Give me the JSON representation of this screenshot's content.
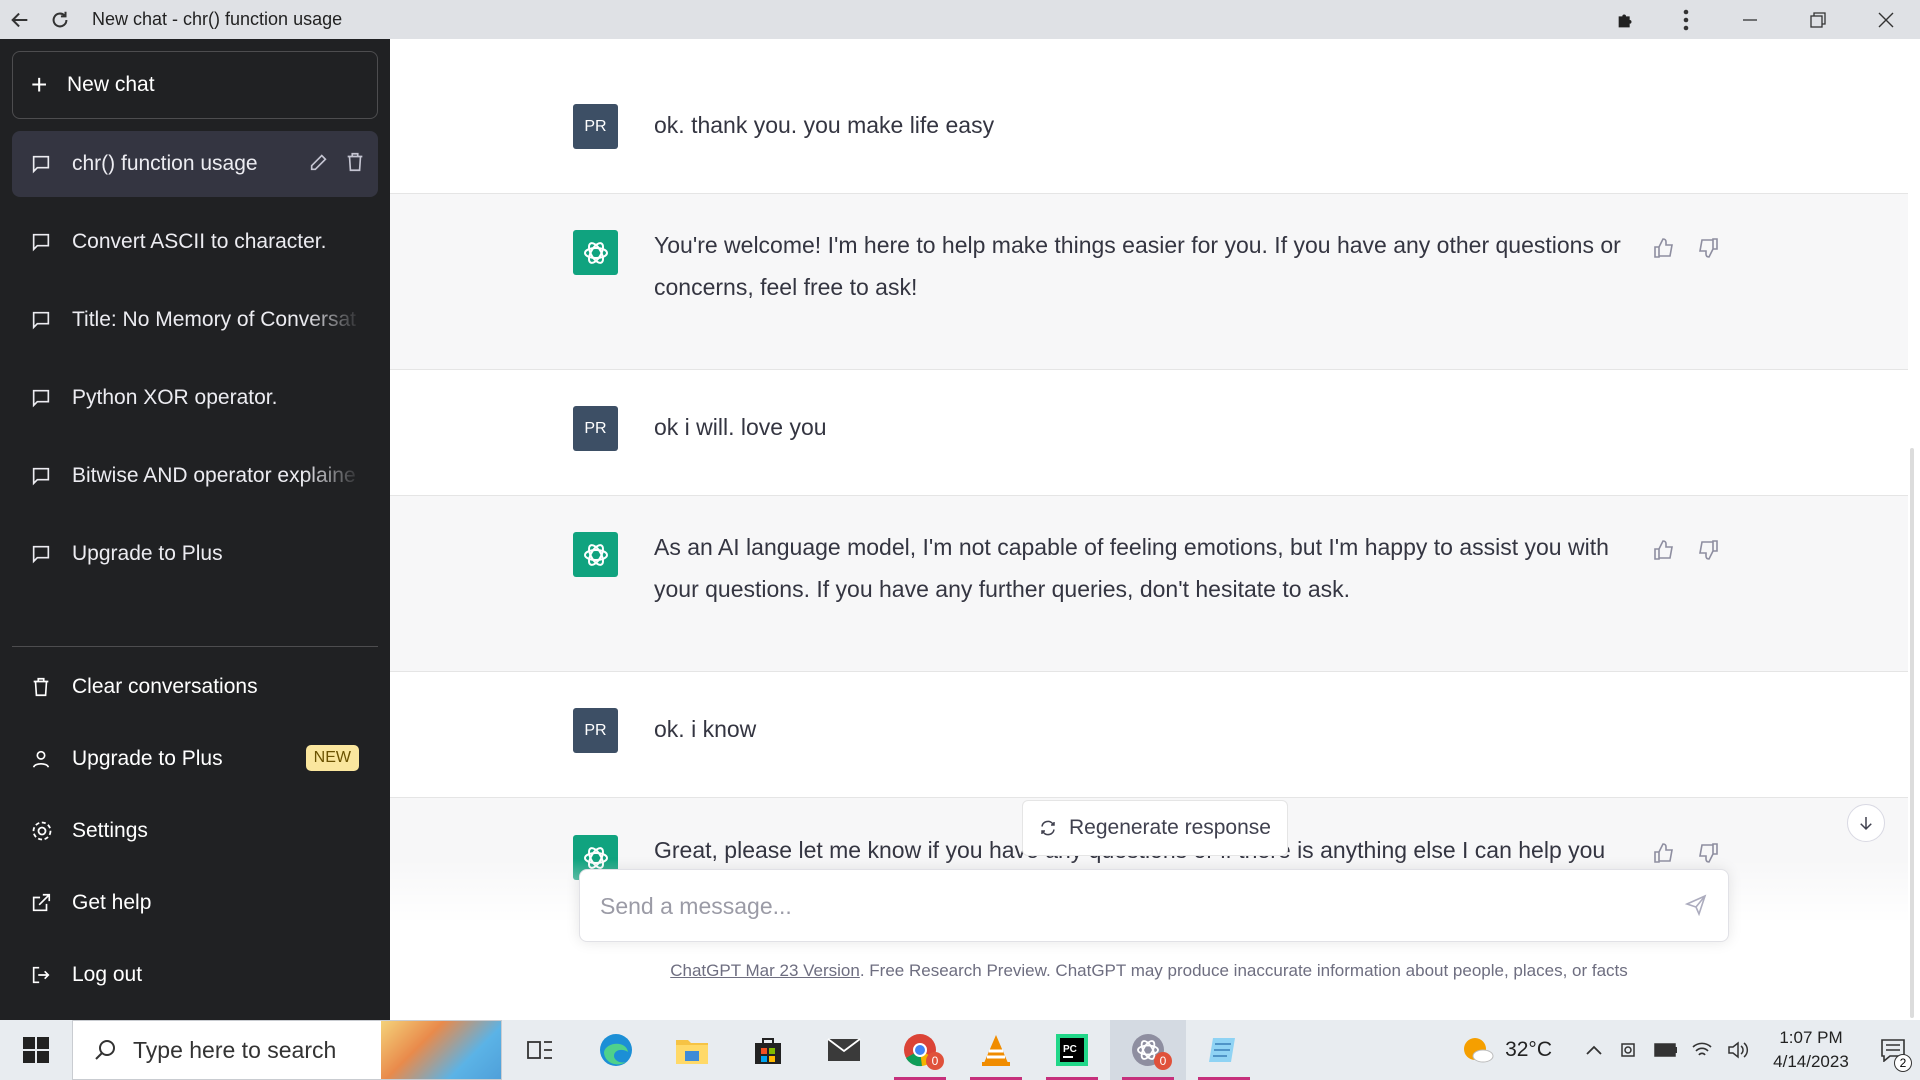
{
  "window": {
    "title": "New chat - chr() function usage"
  },
  "sidebar": {
    "new_chat_label": "New chat",
    "conversations": [
      {
        "label": "chr() function usage",
        "active": true
      },
      {
        "label": "Convert ASCII to character."
      },
      {
        "label": "Title: No Memory of Conversat"
      },
      {
        "label": "Python XOR operator."
      },
      {
        "label": "Bitwise AND operator explaine"
      },
      {
        "label": "Upgrade to Plus"
      }
    ],
    "menu": {
      "clear": "Clear conversations",
      "upgrade": "Upgrade to Plus",
      "upgrade_badge": "NEW",
      "settings": "Settings",
      "help": "Get help",
      "logout": "Log out"
    }
  },
  "chat": {
    "user_initials": "PR",
    "messages": [
      {
        "role": "user",
        "text": "ok. thank you. you make life easy"
      },
      {
        "role": "assistant",
        "text": "You're welcome! I'm here to help make things easier for you. If you have any other questions or concerns, feel free to ask!"
      },
      {
        "role": "user",
        "text": "ok i will. love you"
      },
      {
        "role": "assistant",
        "text": "As an AI language model, I'm not capable of feeling emotions, but I'm happy to assist you with your questions. If you have any further queries, don't hesitate to ask."
      },
      {
        "role": "user",
        "text": "ok. i know"
      },
      {
        "role": "assistant",
        "text": "Great, please let me know if you have any questions or if there is anything else I can help you with."
      }
    ],
    "regenerate_label": "Regenerate response",
    "input_placeholder": "Send a message...",
    "footer_link": "ChatGPT Mar 23 Version",
    "footer_text": ". Free Research Preview. ChatGPT may produce inaccurate information about people, places, or facts"
  },
  "taskbar": {
    "search_placeholder": "Type here to search",
    "chrome_badge": "0",
    "chatgpt_badge": "0",
    "weather": "32°C",
    "time": "1:07 PM",
    "date": "4/14/2023",
    "notification_count": "2"
  },
  "colors": {
    "sidebar_bg": "#202123",
    "accent_green": "#10a37f",
    "user_avatar": "#3d4f65"
  }
}
